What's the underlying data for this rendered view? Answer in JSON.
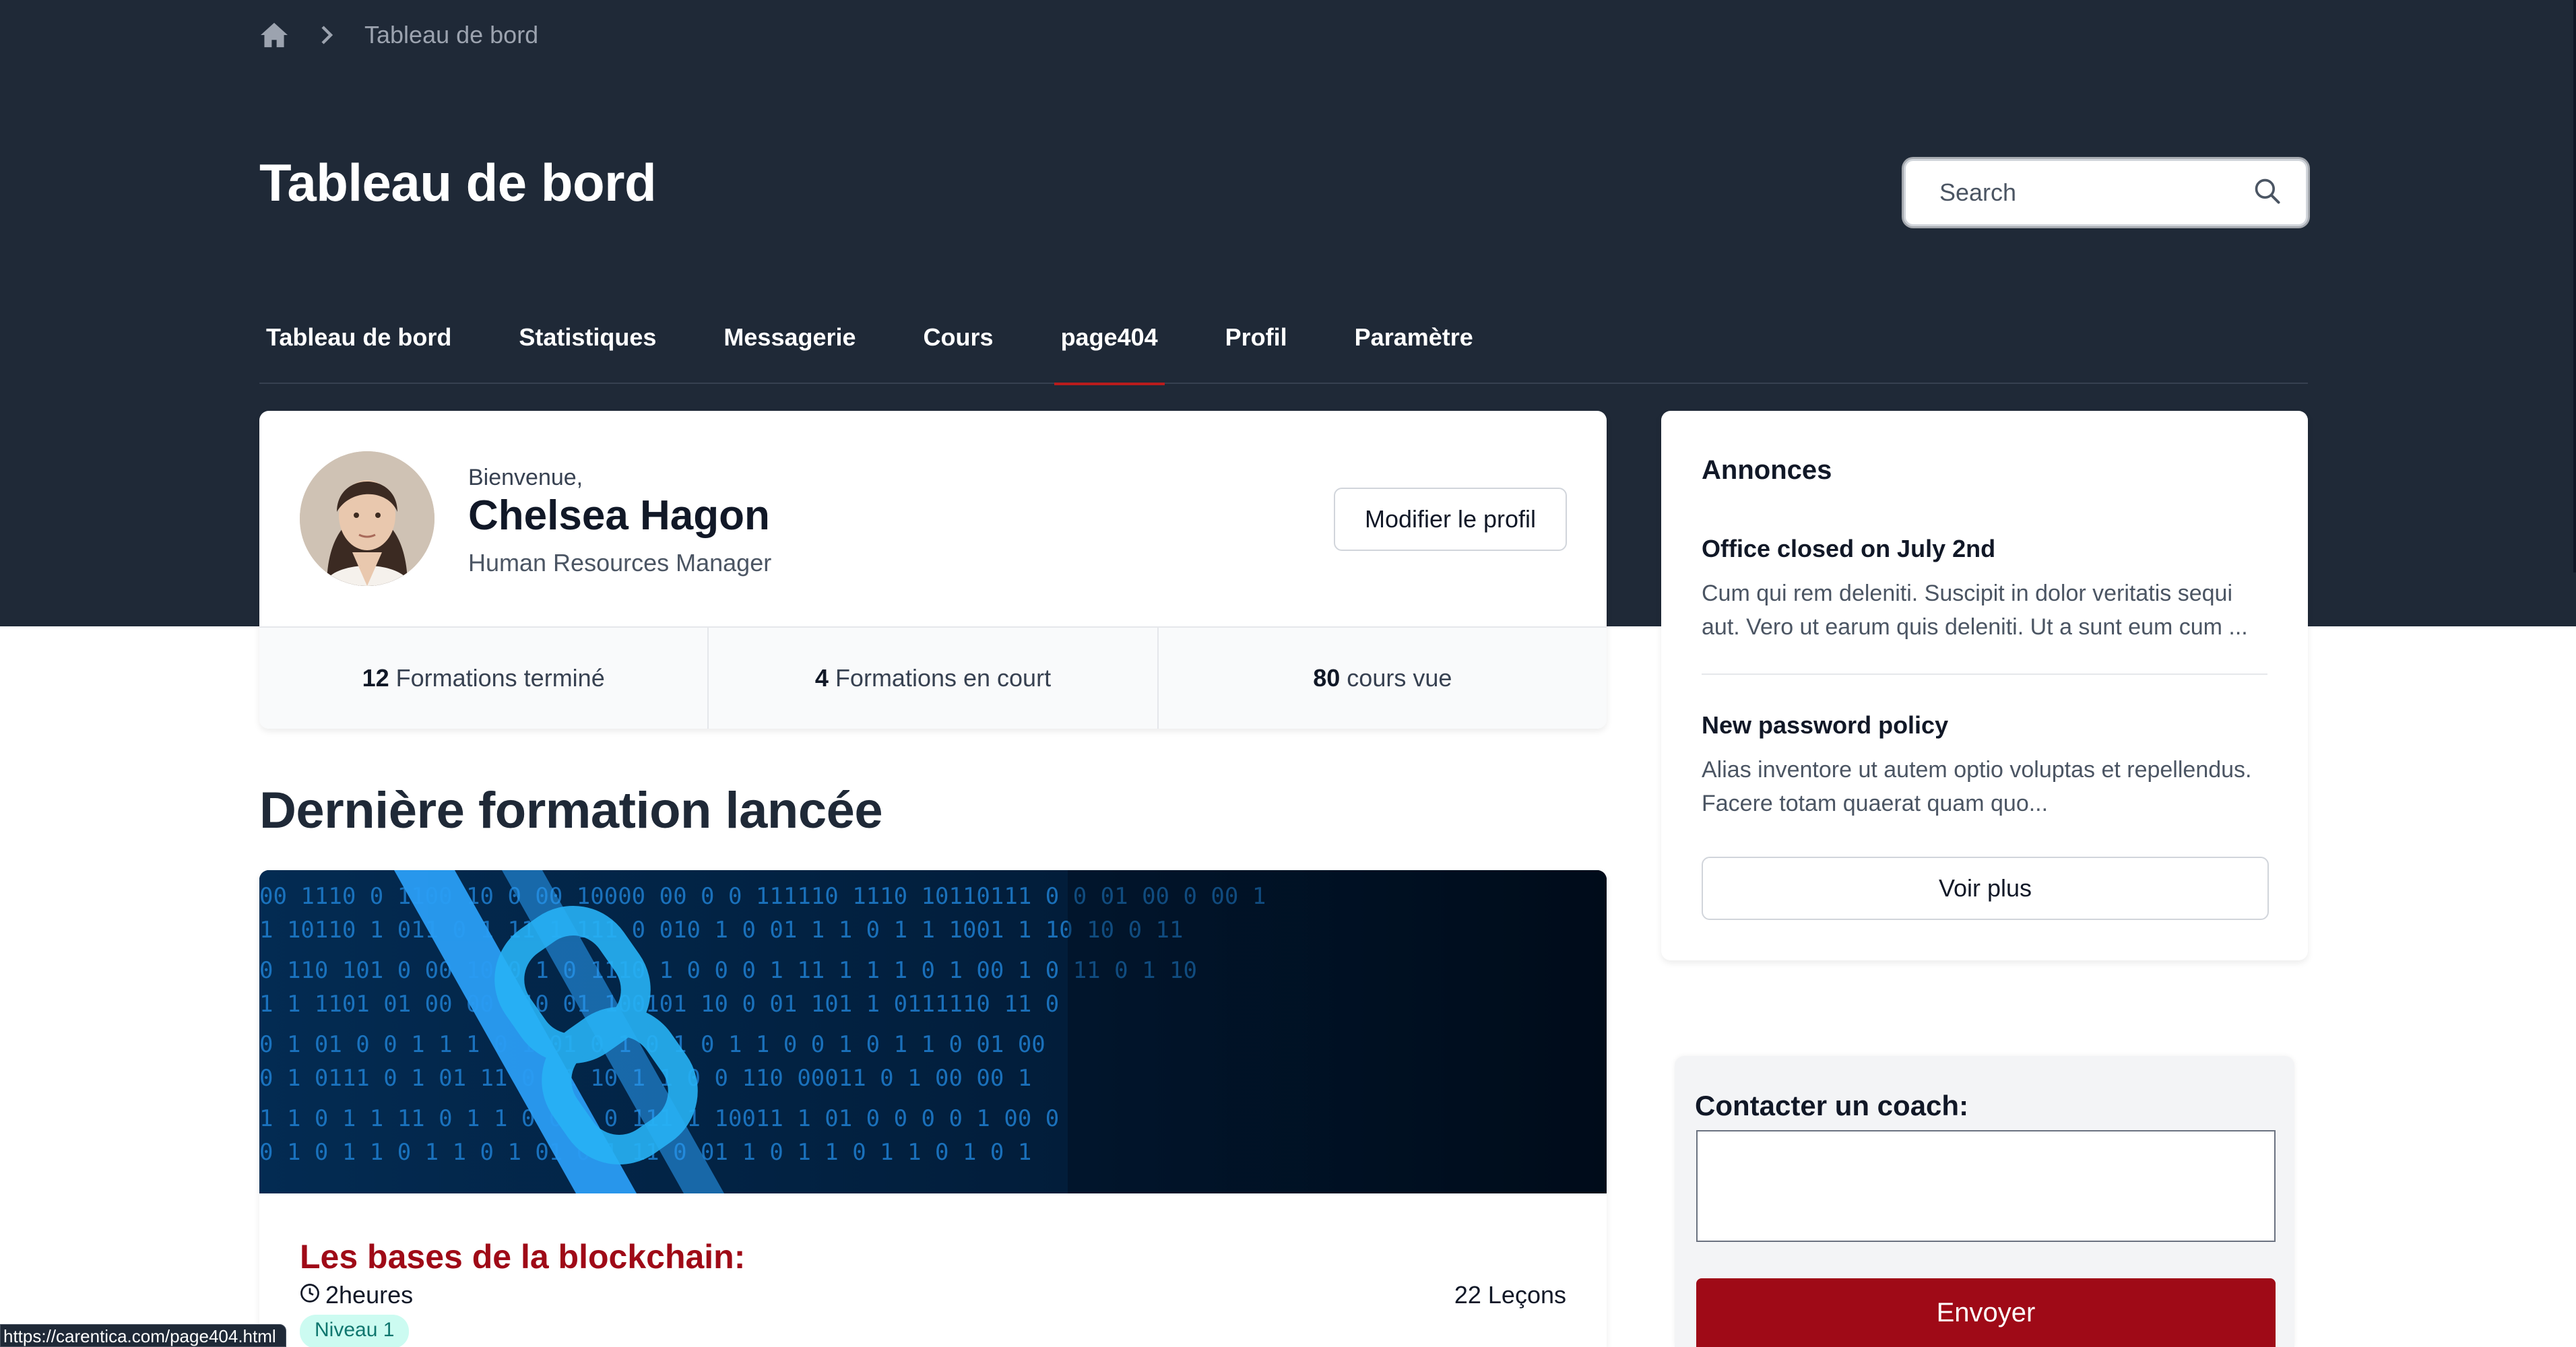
{
  "breadcrumb": {
    "current": "Tableau de bord"
  },
  "header": {
    "title": "Tableau de bord"
  },
  "search": {
    "placeholder": "Search"
  },
  "nav": {
    "items": [
      {
        "label": "Tableau de bord"
      },
      {
        "label": "Statistiques"
      },
      {
        "label": "Messagerie"
      },
      {
        "label": "Cours"
      },
      {
        "label": "page404",
        "active": true
      },
      {
        "label": "Profil"
      },
      {
        "label": "Paramètre"
      }
    ]
  },
  "profile": {
    "welcome": "Bienvenue,",
    "name": "Chelsea Hagon",
    "role": "Human Resources Manager",
    "edit_label": "Modifier le profil"
  },
  "stats": [
    {
      "value": "12",
      "label": "Formations terminé"
    },
    {
      "value": "4",
      "label": "Formations en court"
    },
    {
      "value": "80",
      "label": "cours vue"
    }
  ],
  "latest": {
    "section_title": "Dernière formation lancée",
    "course_title": "Les bases de la blockchain:",
    "duration": "2heures",
    "lessons": "22 Leçons",
    "level": "Niveau 1"
  },
  "announcements": {
    "heading": "Annonces",
    "items": [
      {
        "title": "Office closed on July 2nd",
        "text": "Cum qui rem deleniti. Suscipit in dolor veritatis sequi aut. Vero ut earum quis deleniti. Ut a sunt eum cum ..."
      },
      {
        "title": "New password policy",
        "text": "Alias inventore ut autem optio voluptas et repellendus. Facere totam quaerat quam quo..."
      }
    ],
    "more_label": "Voir plus"
  },
  "coach": {
    "label": "Contacter un coach:",
    "message_value": "",
    "send_label": "Envoyer"
  },
  "status_url": "https://carentica.com/page404.html",
  "colors": {
    "header_bg": "#1f2937",
    "accent": "#9f0a17",
    "active_tab": "#b91c1c"
  }
}
